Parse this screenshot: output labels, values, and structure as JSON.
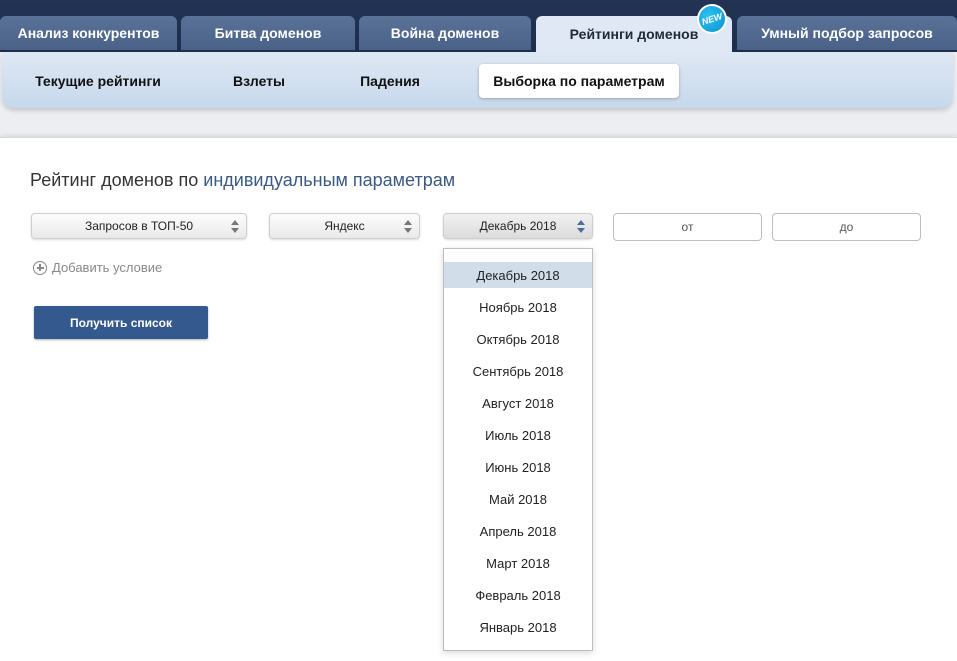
{
  "tabs": [
    {
      "label": "Анализ конкурентов"
    },
    {
      "label": "Битва доменов"
    },
    {
      "label": "Война доменов"
    },
    {
      "label": "Рейтинги доменов",
      "active": true
    },
    {
      "label": "Умный подбор запросов"
    }
  ],
  "new_badge": "NEW",
  "subtabs": [
    {
      "label": "Текущие рейтинги"
    },
    {
      "label": "Взлеты"
    },
    {
      "label": "Падения"
    },
    {
      "label": "Выборка по параметрам",
      "active": true
    }
  ],
  "heading": {
    "prefix": "Рейтинг доменов по ",
    "highlight": "индивидуальным параметрам"
  },
  "filters": {
    "metric": "Запросов в ТОП-50",
    "engine": "Яндекс",
    "month": "Декабрь 2018",
    "from_placeholder": "от",
    "to_placeholder": "до"
  },
  "add_condition": "Добавить условие",
  "submit": "Получить список",
  "month_options": [
    "Декабрь 2018",
    "Ноябрь 2018",
    "Октябрь 2018",
    "Сентябрь 2018",
    "Август 2018",
    "Июль 2018",
    "Июнь 2018",
    "Май 2018",
    "Апрель 2018",
    "Март 2018",
    "Февраль 2018",
    "Январь 2018"
  ],
  "selected_month": "Декабрь 2018",
  "colors": {
    "header_bg": "#223354",
    "tab_bg": "#4a6188",
    "accent": "#34598e",
    "highlight_text": "#3b5a82",
    "selected_option": "#d1deea"
  }
}
